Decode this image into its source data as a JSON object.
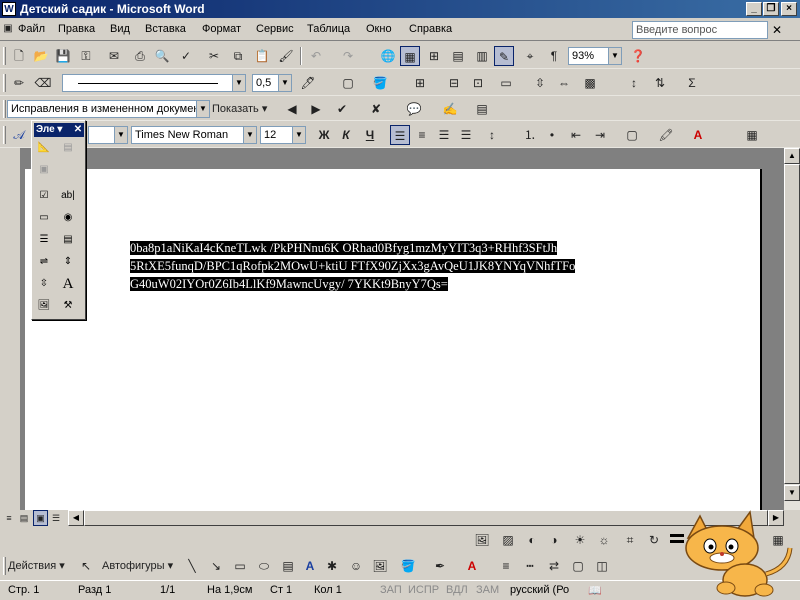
{
  "window": {
    "title": "Детский садик - Microsoft Word",
    "app_icon": "W"
  },
  "menu": [
    {
      "label": "Файл"
    },
    {
      "label": "Правка"
    },
    {
      "label": "Вид"
    },
    {
      "label": "Вставка"
    },
    {
      "label": "Формат"
    },
    {
      "label": "Сервис"
    },
    {
      "label": "Таблица"
    },
    {
      "label": "Окно"
    },
    {
      "label": "Справка"
    }
  ],
  "help_box": {
    "placeholder": "Введите вопрос"
  },
  "standard_toolbar": {
    "zoom": "93%"
  },
  "line_toolbar": {
    "line_width": "0,5"
  },
  "reviewing_toolbar": {
    "markup_mode": "Исправления в измененном документ",
    "show_label": "Показать"
  },
  "formatting_toolbar": {
    "font": "Times New Roman",
    "size": "12",
    "bold": "Ж",
    "italic": "К",
    "underline": "Ч"
  },
  "floating_toolbar": {
    "title": "Эле"
  },
  "document": {
    "selected_lines": [
      "0ba8p1aNiKaI4cKneTLwk /PkPHNnu6K ORhad0Bfyg1mzMyYIT3q3+RHhf3SFtJh",
      "5RtXE5funqD/BPC1qRofpk2MOwU+ktiU FTfX90ZjXx3gAvQeU1JK8YNYqVNhfTFo",
      "G40uW02IYOr0Z6Ib4LlKf9MawncUvgy/ 7YKKt9BnyY7Qs="
    ]
  },
  "drawing_toolbar": {
    "actions_label": "Действия",
    "autoshapes_label": "Автофигуры"
  },
  "status": {
    "page": "Стр. 1",
    "section": "Разд 1",
    "pages": "1/1",
    "position": "На 1,9см",
    "line": "Ст 1",
    "column": "Кол 1",
    "rec": "ЗАП",
    "trk": "ИСПР",
    "ext": "ВДЛ",
    "ovr": "ЗАМ",
    "language": "русский (Ро"
  }
}
